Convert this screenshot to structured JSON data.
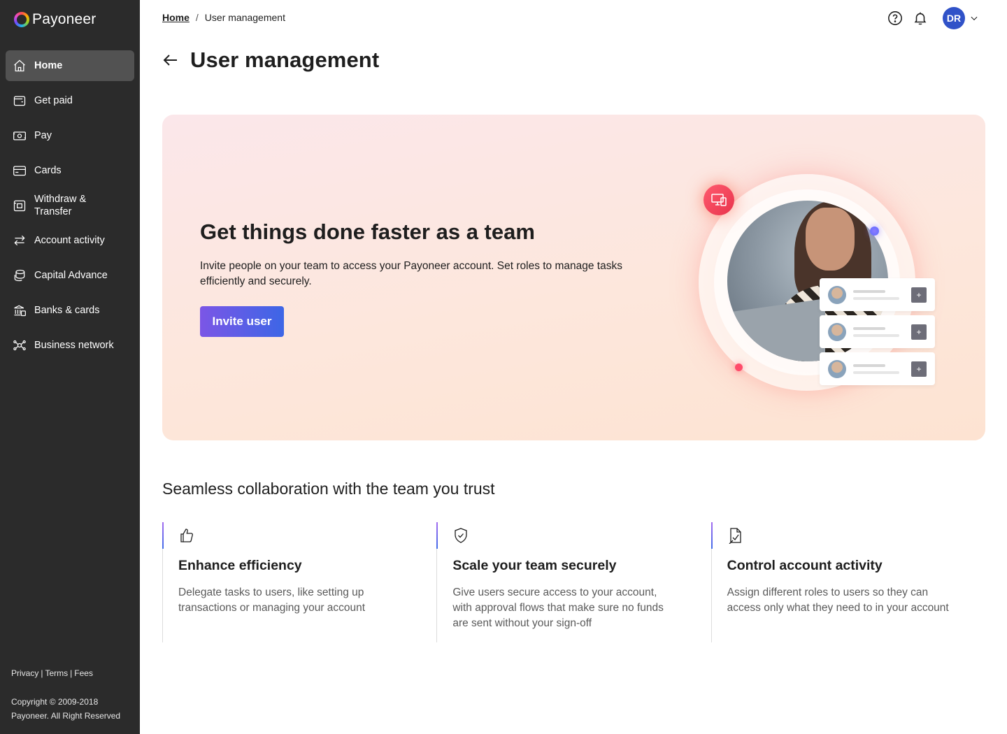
{
  "brand": {
    "name": "Payoneer"
  },
  "sidebar": {
    "items": [
      {
        "label": "Home",
        "icon": "home-icon",
        "active": true
      },
      {
        "label": "Get paid",
        "icon": "wallet-icon"
      },
      {
        "label": "Pay",
        "icon": "cash-icon"
      },
      {
        "label": "Cards",
        "icon": "card-icon"
      },
      {
        "label": "Withdraw & Transfer",
        "icon": "withdraw-icon"
      },
      {
        "label": "Account activity",
        "icon": "transfer-arrows-icon"
      },
      {
        "label": "Capital Advance",
        "icon": "coins-icon"
      },
      {
        "label": "Banks & cards",
        "icon": "bank-icon"
      },
      {
        "label": "Business network",
        "icon": "network-icon"
      }
    ],
    "footer": {
      "privacy": "Privacy",
      "terms": "Terms",
      "fees": "Fees",
      "separator": "|",
      "copyright": "Copyright © 2009-2018 Payoneer. All Right Reserved"
    }
  },
  "header": {
    "breadcrumb": {
      "home": "Home",
      "separator": "/",
      "current": "User management"
    },
    "avatar_initials": "DR",
    "icons": [
      "help-icon",
      "bell-icon",
      "chevron-down-icon"
    ]
  },
  "page": {
    "title": "User management"
  },
  "hero": {
    "title": "Get things done faster as a team",
    "description": "Invite people on your team to access your Payoneer account. Set roles to manage tasks efficiently and securely.",
    "button_label": "Invite user",
    "mini_plus": "+"
  },
  "features": {
    "title": "Seamless collaboration with the team you trust",
    "items": [
      {
        "icon": "thumbs-up-icon",
        "title": "Enhance efficiency",
        "description": "Delegate tasks to users, like setting up transactions or managing your account"
      },
      {
        "icon": "shield-check-icon",
        "title": "Scale your team securely",
        "description": "Give users secure access to your account, with approval flows that make sure no funds are sent without your sign-off"
      },
      {
        "icon": "document-check-icon",
        "title": "Control account activity",
        "description": "Assign different roles to users so they can access only what they need to in your account"
      }
    ]
  },
  "colors": {
    "sidebar_bg": "#2b2b2b",
    "sidebar_active": "#525252",
    "accent_purple": "#7b56e6",
    "accent_blue": "#3d66e6",
    "avatar_bg": "#3052c8"
  }
}
